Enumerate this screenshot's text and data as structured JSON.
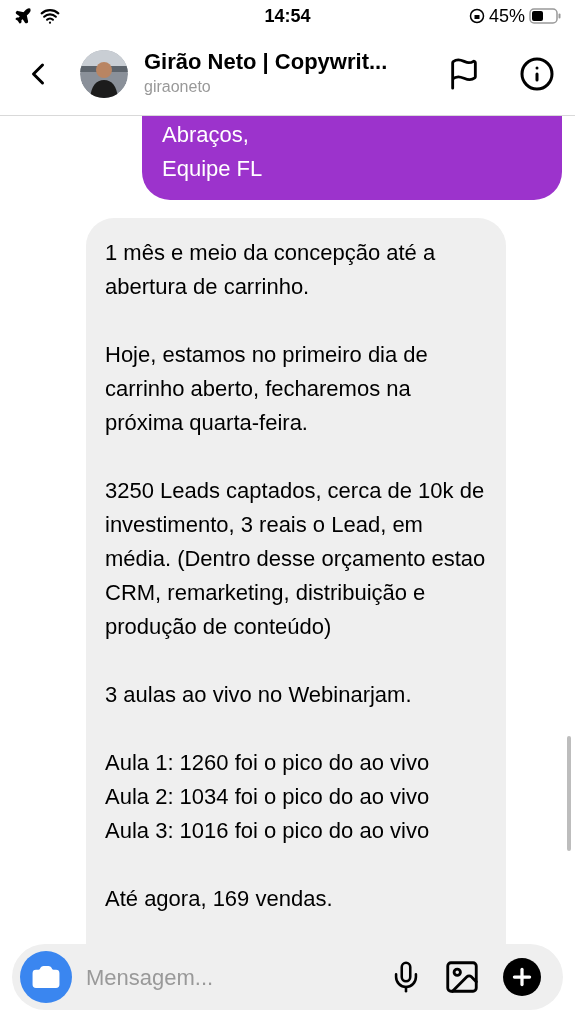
{
  "status_bar": {
    "time": "14:54",
    "battery": "45%"
  },
  "header": {
    "title": "Girão Neto | Copywrit...",
    "username": "giraoneto"
  },
  "messages": [
    {
      "kind": "sent",
      "paragraphs": [
        "Abraços,\nEquipe FL"
      ]
    },
    {
      "kind": "received",
      "paragraphs": [
        "1 mês e meio da concepção até a abertura de carrinho.",
        "Hoje, estamos no primeiro dia de carrinho aberto, fecharemos na próxima quarta-feira.",
        "3250 Leads captados, cerca de 10k de investimento, 3 reais o Lead, em média. (Dentro desse orçamento estao CRM, remarketing, distribuição e produção de conteúdo)",
        "3 aulas ao vivo no Webinarjam.",
        "Aula 1: 1260 foi o pico do ao vivo\nAula 2: 1034 foi o pico do ao vivo\nAula 3: 1016 foi o pico do ao vivo",
        "Até agora, 169 vendas."
      ]
    }
  ],
  "composer": {
    "placeholder": "Mensagem..."
  }
}
